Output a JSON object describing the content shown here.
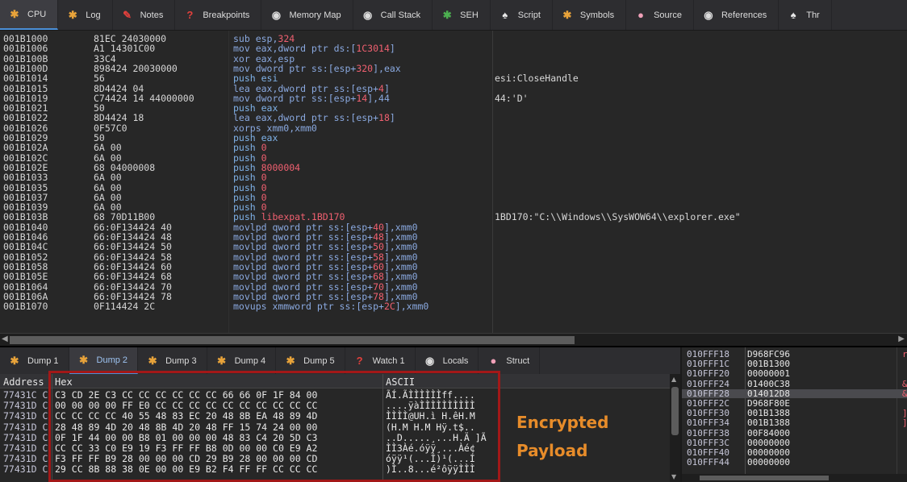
{
  "top_tabs": [
    {
      "label": "CPU",
      "icon": "cpu-icon",
      "glyph": "✱",
      "color": "#e8a33a",
      "active": true
    },
    {
      "label": "Log",
      "icon": "log-icon",
      "glyph": "✱",
      "color": "#e8a33a"
    },
    {
      "label": "Notes",
      "icon": "notes-icon",
      "glyph": "✎",
      "color": "#e2403c"
    },
    {
      "label": "Breakpoints",
      "icon": "breakpoints-icon",
      "glyph": "?",
      "color": "#e2403c"
    },
    {
      "label": "Memory Map",
      "icon": "memory-map-icon",
      "glyph": "◉",
      "color": "#dcdcdc"
    },
    {
      "label": "Call Stack",
      "icon": "call-stack-icon",
      "glyph": "◉",
      "color": "#dcdcdc"
    },
    {
      "label": "SEH",
      "icon": "seh-icon",
      "glyph": "✱",
      "color": "#4caf50"
    },
    {
      "label": "Script",
      "icon": "script-icon",
      "glyph": "♠",
      "color": "#e8e8e8"
    },
    {
      "label": "Symbols",
      "icon": "symbols-icon",
      "glyph": "✱",
      "color": "#e8a33a"
    },
    {
      "label": "Source",
      "icon": "source-icon",
      "glyph": "●",
      "color": "#f0a0b8"
    },
    {
      "label": "References",
      "icon": "references-icon",
      "glyph": "◉",
      "color": "#dcdcdc"
    },
    {
      "label": "Thr",
      "icon": "threads-icon",
      "glyph": "♠",
      "color": "#e8e8e8"
    }
  ],
  "disasm": [
    {
      "addr": "001B1000",
      "bytes": "81EC 24030000",
      "pre": "sub esp,",
      "val": "324",
      "post": "",
      "cmt": ""
    },
    {
      "addr": "001B1006",
      "bytes": "A1 14301C00",
      "pre": "mov eax,dword ptr ds:[",
      "val": "1C3014",
      "post": "]",
      "cmt": ""
    },
    {
      "addr": "001B100B",
      "bytes": "33C4",
      "pre": "xor eax,esp",
      "val": "",
      "post": "",
      "cmt": ""
    },
    {
      "addr": "001B100D",
      "bytes": "898424 20030000",
      "pre": "mov dword ptr ss:[esp+",
      "val": "320",
      "post": "],eax",
      "cmt": ""
    },
    {
      "addr": "001B1014",
      "bytes": "56",
      "pre": "push esi",
      "val": "",
      "post": "",
      "cmt": "esi:CloseHandle"
    },
    {
      "addr": "001B1015",
      "bytes": "8D4424 04",
      "pre": "lea eax,dword ptr ss:[esp+",
      "val": "4",
      "post": "]",
      "cmt": ""
    },
    {
      "addr": "001B1019",
      "bytes": "C74424 14 44000000",
      "pre": "mov dword ptr ss:[esp+",
      "val": "14",
      "post": "],44",
      "cmt": "44:'D'"
    },
    {
      "addr": "001B1021",
      "bytes": "50",
      "pre": "push eax",
      "val": "",
      "post": "",
      "cmt": ""
    },
    {
      "addr": "001B1022",
      "bytes": "8D4424 18",
      "pre": "lea eax,dword ptr ss:[esp+",
      "val": "18",
      "post": "]",
      "cmt": ""
    },
    {
      "addr": "001B1026",
      "bytes": "0F57C0",
      "pre": "xorps xmm0,xmm0",
      "val": "",
      "post": "",
      "cmt": ""
    },
    {
      "addr": "001B1029",
      "bytes": "50",
      "pre": "push eax",
      "val": "",
      "post": "",
      "cmt": ""
    },
    {
      "addr": "001B102A",
      "bytes": "6A 00",
      "pre": "push ",
      "val": "0",
      "post": "",
      "cmt": ""
    },
    {
      "addr": "001B102C",
      "bytes": "6A 00",
      "pre": "push ",
      "val": "0",
      "post": "",
      "cmt": ""
    },
    {
      "addr": "001B102E",
      "bytes": "68 04000008",
      "pre": "push ",
      "val": "8000004",
      "post": "",
      "cmt": ""
    },
    {
      "addr": "001B1033",
      "bytes": "6A 00",
      "pre": "push ",
      "val": "0",
      "post": "",
      "cmt": ""
    },
    {
      "addr": "001B1035",
      "bytes": "6A 00",
      "pre": "push ",
      "val": "0",
      "post": "",
      "cmt": ""
    },
    {
      "addr": "001B1037",
      "bytes": "6A 00",
      "pre": "push ",
      "val": "0",
      "post": "",
      "cmt": ""
    },
    {
      "addr": "001B1039",
      "bytes": "6A 00",
      "pre": "push ",
      "val": "0",
      "post": "",
      "cmt": ""
    },
    {
      "addr": "001B103B",
      "bytes": "68 70D11B00",
      "pre": "push ",
      "val": "libexpat.1BD170",
      "post": "",
      "cmt": "1BD170:\"C:\\\\Windows\\\\SysWOW64\\\\explorer.exe\""
    },
    {
      "addr": "001B1040",
      "bytes": "66:0F134424 40",
      "pre": "movlpd qword ptr ss:[esp+",
      "val": "40",
      "post": "],xmm0",
      "cmt": ""
    },
    {
      "addr": "001B1046",
      "bytes": "66:0F134424 48",
      "pre": "movlpd qword ptr ss:[esp+",
      "val": "48",
      "post": "],xmm0",
      "cmt": ""
    },
    {
      "addr": "001B104C",
      "bytes": "66:0F134424 50",
      "pre": "movlpd qword ptr ss:[esp+",
      "val": "50",
      "post": "],xmm0",
      "cmt": ""
    },
    {
      "addr": "001B1052",
      "bytes": "66:0F134424 58",
      "pre": "movlpd qword ptr ss:[esp+",
      "val": "58",
      "post": "],xmm0",
      "cmt": ""
    },
    {
      "addr": "001B1058",
      "bytes": "66:0F134424 60",
      "pre": "movlpd qword ptr ss:[esp+",
      "val": "60",
      "post": "],xmm0",
      "cmt": ""
    },
    {
      "addr": "001B105E",
      "bytes": "66:0F134424 68",
      "pre": "movlpd qword ptr ss:[esp+",
      "val": "68",
      "post": "],xmm0",
      "cmt": ""
    },
    {
      "addr": "001B1064",
      "bytes": "66:0F134424 70",
      "pre": "movlpd qword ptr ss:[esp+",
      "val": "70",
      "post": "],xmm0",
      "cmt": ""
    },
    {
      "addr": "001B106A",
      "bytes": "66:0F134424 78",
      "pre": "movlpd qword ptr ss:[esp+",
      "val": "78",
      "post": "],xmm0",
      "cmt": ""
    },
    {
      "addr": "001B1070",
      "bytes": "0F114424 2C",
      "pre": "movups xmmword ptr ss:[esp+",
      "val": "2C",
      "post": "],xmm0",
      "cmt": ""
    }
  ],
  "dump_tabs": [
    {
      "label": "Dump 1",
      "icon": "dump1-icon",
      "glyph": "✱",
      "color": "#e8a33a"
    },
    {
      "label": "Dump 2",
      "icon": "dump2-icon",
      "glyph": "✱",
      "color": "#e8a33a",
      "active": true
    },
    {
      "label": "Dump 3",
      "icon": "dump3-icon",
      "glyph": "✱",
      "color": "#e8a33a"
    },
    {
      "label": "Dump 4",
      "icon": "dump4-icon",
      "glyph": "✱",
      "color": "#e8a33a"
    },
    {
      "label": "Dump 5",
      "icon": "dump5-icon",
      "glyph": "✱",
      "color": "#e8a33a"
    },
    {
      "label": "Watch 1",
      "icon": "watch-icon",
      "glyph": "?",
      "color": "#e2403c"
    },
    {
      "label": "Locals",
      "icon": "locals-icon",
      "glyph": "◉",
      "color": "#dcdcdc"
    },
    {
      "label": "Struct",
      "icon": "struct-icon",
      "glyph": "●",
      "color": "#f0a0b8"
    }
  ],
  "dump": {
    "headers": {
      "address": "Address",
      "hex": "Hex",
      "ascii": "ASCII"
    },
    "rows": [
      {
        "addr": "77431C C",
        "hex": "C3 CD 2E C3 CC CC CC CC CC CC 66 66 0F 1F 84 00",
        "ascii": "ÃÍ.ÃÌÌÌÌÌÌff...."
      },
      {
        "addr": "77431D C",
        "hex": "00 00 00 00 FF E0 CC CC CC CC CC CC CC CC CC CC",
        "ascii": "....ÿàÌÌÌÌÌÌÌÌÌÌ"
      },
      {
        "addr": "77431D C",
        "hex": "CC CC CC CC 40 55 48 83 EC 20 48 8B EA 48 89 4D",
        "ascii": "ÌÌÌÌ@UH.ì H.êH.M"
      },
      {
        "addr": "77431D C",
        "hex": "28 48 89 4D 20 48 8B 4D 20 48 FF 15 74 24 00 00",
        "ascii": "(H.M H.M Hÿ.t$.."
      },
      {
        "addr": "77431D C",
        "hex": "0F 1F 44 00 00 B8 01 00 00 00 48 83 C4 20 5D C3",
        "ascii": "..D.....¸...H.Ä ]Ã"
      },
      {
        "addr": "77431D C",
        "hex": "CC CC 33 C0 E9 19 F3 FF FF B8 0D 00 00 C0 E9 A2",
        "ascii": "ÌÌ3Àé.óÿÿ¸...Àé¢"
      },
      {
        "addr": "77431D C",
        "hex": "F3 FF FF B9 28 00 00 00 CD 29 B9 28 00 00 00 CD",
        "ascii": "óÿÿ¹(...Í)¹(...Í"
      },
      {
        "addr": "77431D C",
        "hex": "29 CC 8B 88 38 0E 00 00 E9 B2 F4 FF FF CC CC CC",
        "ascii": ")Ì..8...é²ôÿÿÌÌÌ"
      }
    ]
  },
  "annotation": {
    "line1": "Encrypted",
    "line2": "Payload",
    "color": "#e78c2a"
  },
  "stack": [
    {
      "addr": "010FFF18",
      "val": "D968FC96",
      "cmt": "r"
    },
    {
      "addr": "010FFF1C",
      "val": "001B1300",
      "cmt": ""
    },
    {
      "addr": "010FFF20",
      "val": "00000001",
      "cmt": ""
    },
    {
      "addr": "010FFF24",
      "val": "01400C38",
      "cmt": "&"
    },
    {
      "addr": "010FFF28",
      "val": "014012D8",
      "cmt": "&",
      "selected": true
    },
    {
      "addr": "010FFF2C",
      "val": "D968F80E",
      "cmt": ""
    },
    {
      "addr": "010FFF30",
      "val": "001B1388",
      "cmt": "]"
    },
    {
      "addr": "010FFF34",
      "val": "001B1388",
      "cmt": "]"
    },
    {
      "addr": "010FFF38",
      "val": "00F84000",
      "cmt": ""
    },
    {
      "addr": "010FFF3C",
      "val": "00000000",
      "cmt": ""
    },
    {
      "addr": "010FFF40",
      "val": "00000000",
      "cmt": ""
    },
    {
      "addr": "010FFF44",
      "val": "00000000",
      "cmt": ""
    }
  ]
}
